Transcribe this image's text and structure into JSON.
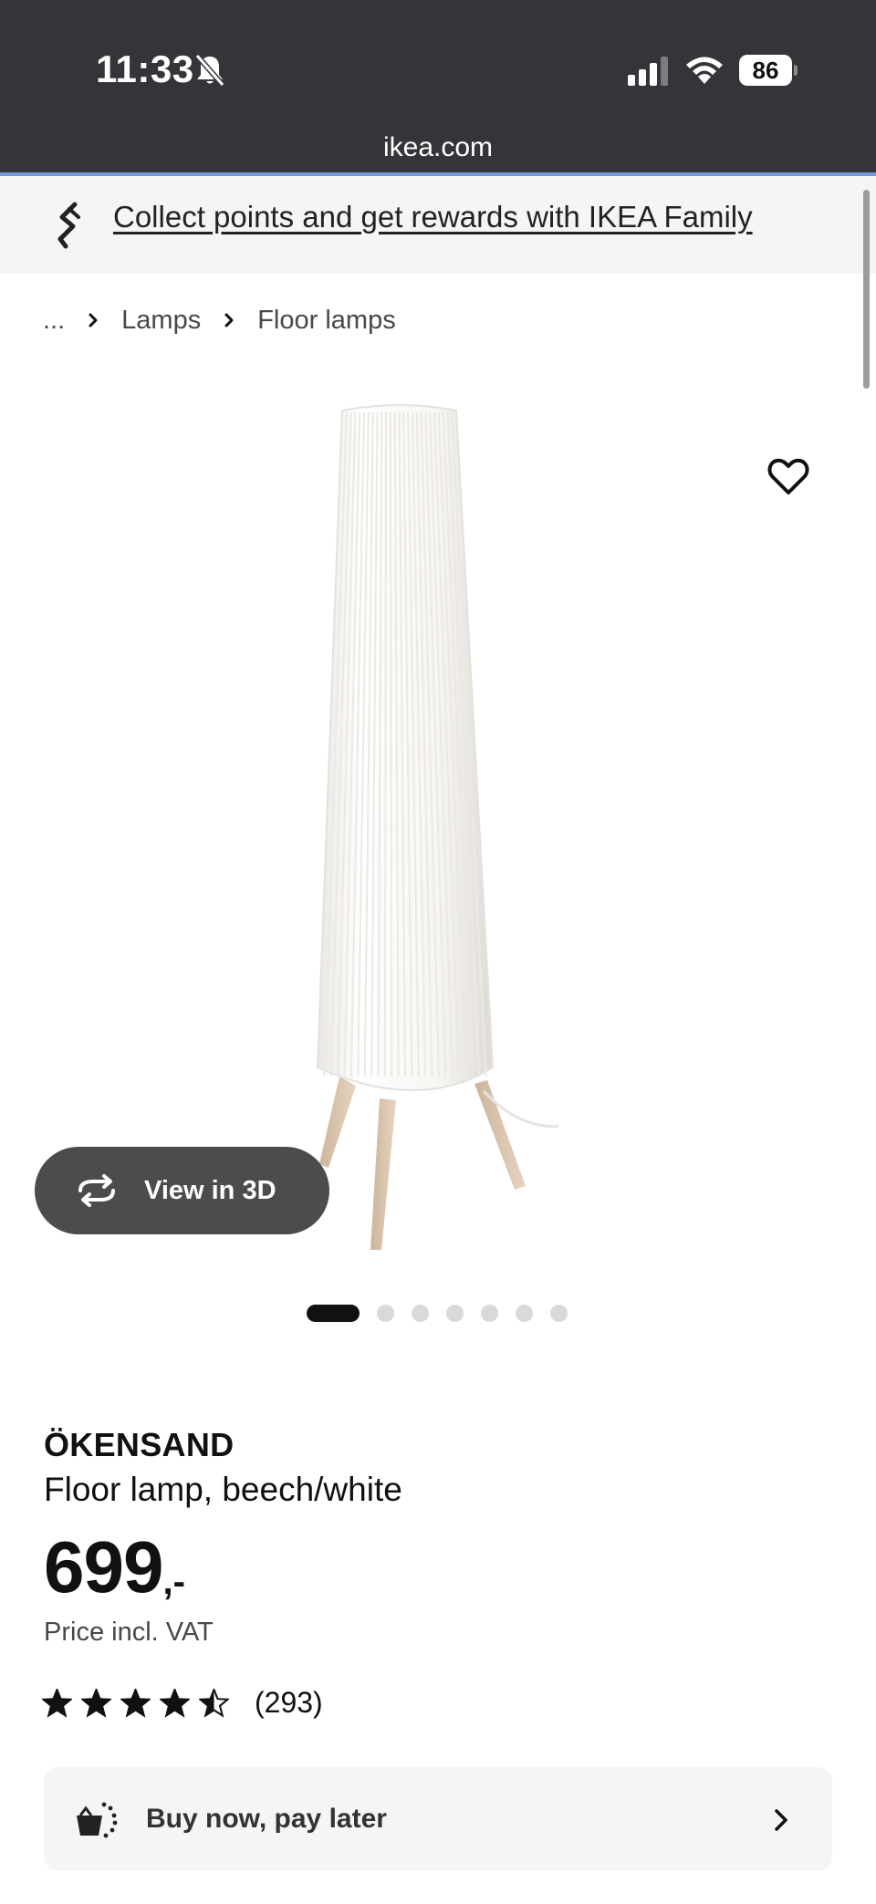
{
  "status_bar": {
    "time": "11:33",
    "battery": "86",
    "url": "ikea.com",
    "icons": [
      "bell-slash-icon",
      "cellular-signal-icon",
      "wifi-icon",
      "battery-icon"
    ]
  },
  "banner": {
    "icon": "ikea-family-icon",
    "text": "Collect points and get rewards with IKEA Family"
  },
  "breadcrumb": {
    "ellipsis": "...",
    "items": [
      "Lamps",
      "Floor lamps"
    ]
  },
  "gallery": {
    "view_in_3d_label": "View in 3D",
    "image_count": 7,
    "active_index": 0
  },
  "product": {
    "name": "ÖKENSAND",
    "description": "Floor lamp, beech/white",
    "price": "699",
    "price_suffix": ",-",
    "vat_note": "Price incl. VAT",
    "rating": 4.5,
    "review_count": "(293)"
  },
  "pay_later": {
    "label": "Buy now, pay later"
  },
  "colors": {
    "status_bar_bg": "#333538",
    "accent_line": "#6f9ad8",
    "banner_bg": "#f5f5f5",
    "pill_bg": "#4c4c4c",
    "text": "#111111"
  }
}
